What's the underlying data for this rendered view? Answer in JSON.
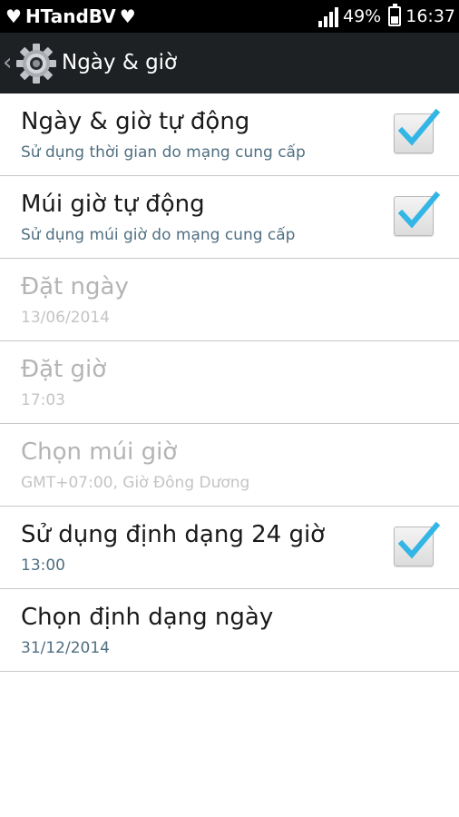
{
  "status_bar": {
    "carrier": "HTandBV",
    "battery_percent_text": "49%",
    "battery_level": 0.49,
    "time": "16:37",
    "heart_icon": "heart-icon",
    "signal_icon": "signal-bars-icon"
  },
  "action_bar": {
    "title": "Ngày & giờ",
    "icon": "gear-icon"
  },
  "settings": [
    {
      "title": "Ngày & giờ tự động",
      "subtitle": "Sử dụng thời gian do mạng cung cấp",
      "enabled": true,
      "checked": true
    },
    {
      "title": "Múi giờ tự động",
      "subtitle": "Sử dụng múi giờ do mạng cung cấp",
      "enabled": true,
      "checked": true
    },
    {
      "title": "Đặt ngày",
      "subtitle": "13/06/2014",
      "enabled": false
    },
    {
      "title": "Đặt giờ",
      "subtitle": "17:03",
      "enabled": false
    },
    {
      "title": "Chọn múi giờ",
      "subtitle": "GMT+07:00, Giờ Đông Dương",
      "enabled": false
    },
    {
      "title": "Sử dụng định dạng 24 giờ",
      "subtitle": "13:00",
      "enabled": true,
      "checked": true
    },
    {
      "title": "Chọn định dạng ngày",
      "subtitle": "31/12/2014",
      "enabled": true
    }
  ],
  "colors": {
    "check_accent": "#33b5e5",
    "action_bar_bg": "#1e2124",
    "subtitle": "#4f6f80"
  }
}
